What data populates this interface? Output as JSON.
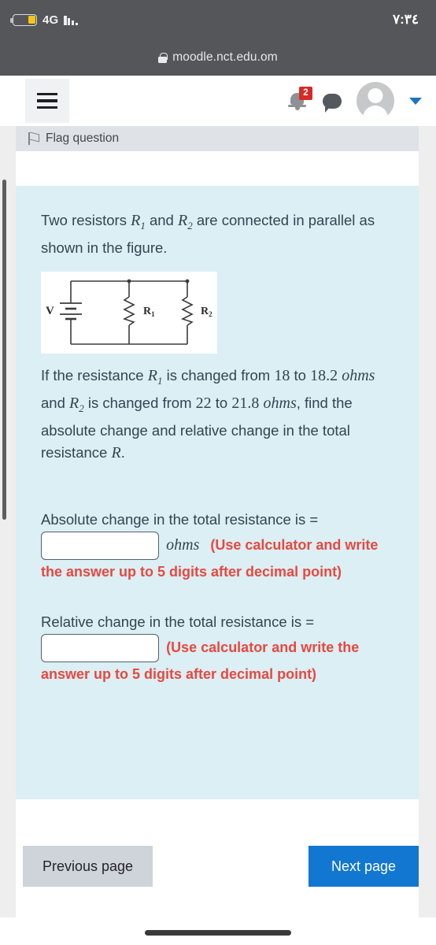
{
  "status_bar": {
    "battery_icon": "battery-icon",
    "network": "4G",
    "signal_icon": "signal-bars-icon",
    "time": "٧:٣٤"
  },
  "url_bar": {
    "lock_icon": "lock-icon",
    "url": "moodle.nct.edu.om"
  },
  "navbar": {
    "menu_icon": "hamburger-menu-icon",
    "notifications_icon": "bell-icon",
    "notifications_count": "2",
    "messages_icon": "speech-bubble-icon",
    "avatar_icon": "user-avatar-icon",
    "dropdown_icon": "chevron-down-icon"
  },
  "question": {
    "flag_icon": "flag-icon",
    "flag_label": "Flag question",
    "intro_part1": "Two resistors ",
    "intro_r1": "R",
    "intro_r1_sub": "1",
    "intro_part2": " and ",
    "intro_r2": "R",
    "intro_r2_sub": "2",
    "intro_part3": " are connected in parallel as shown in the figure.",
    "figure": {
      "name": "parallel-resistor-circuit-diagram",
      "source_label": "V",
      "resistor1_label": "R",
      "resistor1_sub": "1",
      "resistor2_label": "R",
      "resistor2_sub": "2"
    },
    "body_part1": "If the resistance ",
    "body_r1": "R",
    "body_r1_sub": "1",
    "body_part2": " is changed from ",
    "body_r1_from": "18",
    "body_part3": " to ",
    "body_r1_to": "18.2",
    "body_unit1": "ohms",
    "body_part4": " and ",
    "body_r2": "R",
    "body_r2_sub": "2",
    "body_part5": " is changed from ",
    "body_r2_from": "22",
    "body_part6": " to ",
    "body_r2_to": "21.8",
    "body_unit2": "ohms",
    "body_part7": ", find the absolute change and relative change  in the total resistance ",
    "body_R": "R",
    "body_end": "."
  },
  "answers": [
    {
      "prompt": "Absolute change in the total resistance is =",
      "input_value": "",
      "input_placeholder": "",
      "unit": "ohms",
      "note": "(Use calculator and write the answer up to 5 digits after decimal point)"
    },
    {
      "prompt": "Relative change in the total resistance is =",
      "input_value": "",
      "input_placeholder": "",
      "unit": "",
      "note": "(Use calculator and write the answer up to 5 digits after decimal point)"
    }
  ],
  "footer": {
    "previous_label": "Previous page",
    "next_label": "Next page"
  },
  "colors": {
    "question_bg": "#dbeff4",
    "note_red": "#e8483f",
    "next_blue": "#1177d1",
    "prev_gray": "#ced4da",
    "statusbar_gray": "#545659"
  }
}
